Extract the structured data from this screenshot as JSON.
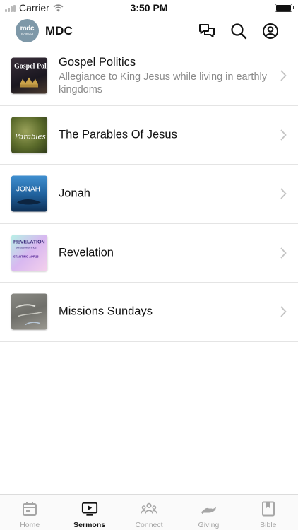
{
  "status_bar": {
    "carrier": "Carrier",
    "time": "3:50 PM"
  },
  "header": {
    "logo_line1": "mdc",
    "logo_line2": "Portland",
    "title": "MDC",
    "icons": [
      "chat-icon",
      "search-icon",
      "account-icon"
    ]
  },
  "series": [
    {
      "title": "Gospel Politics",
      "subtitle": "Allegiance to King Jesus while living in earthly kingdoms",
      "thumb_text": "Gospel Politics"
    },
    {
      "title": "The Parables Of Jesus",
      "subtitle": "",
      "thumb_text": "Parables"
    },
    {
      "title": "Jonah",
      "subtitle": "",
      "thumb_text": "JONAH"
    },
    {
      "title": "Revelation",
      "subtitle": "",
      "thumb_text": "REVELATION",
      "thumb_sub": "Sunday Mornings",
      "thumb_start": "STARTING APR23"
    },
    {
      "title": "Missions Sundays",
      "subtitle": "",
      "thumb_text": ""
    }
  ],
  "tabs": [
    {
      "label": "Home",
      "icon": "calendar-icon",
      "active": false
    },
    {
      "label": "Sermons",
      "icon": "play-screen-icon",
      "active": true
    },
    {
      "label": "Connect",
      "icon": "people-icon",
      "active": false
    },
    {
      "label": "Giving",
      "icon": "giving-hand-icon",
      "active": false
    },
    {
      "label": "Bible",
      "icon": "book-icon",
      "active": false
    }
  ],
  "colors": {
    "active_tab": "#111111",
    "inactive_tab": "#a6a6a6",
    "logo_bg": "#7e98a8",
    "divider": "#e4e4e4"
  }
}
